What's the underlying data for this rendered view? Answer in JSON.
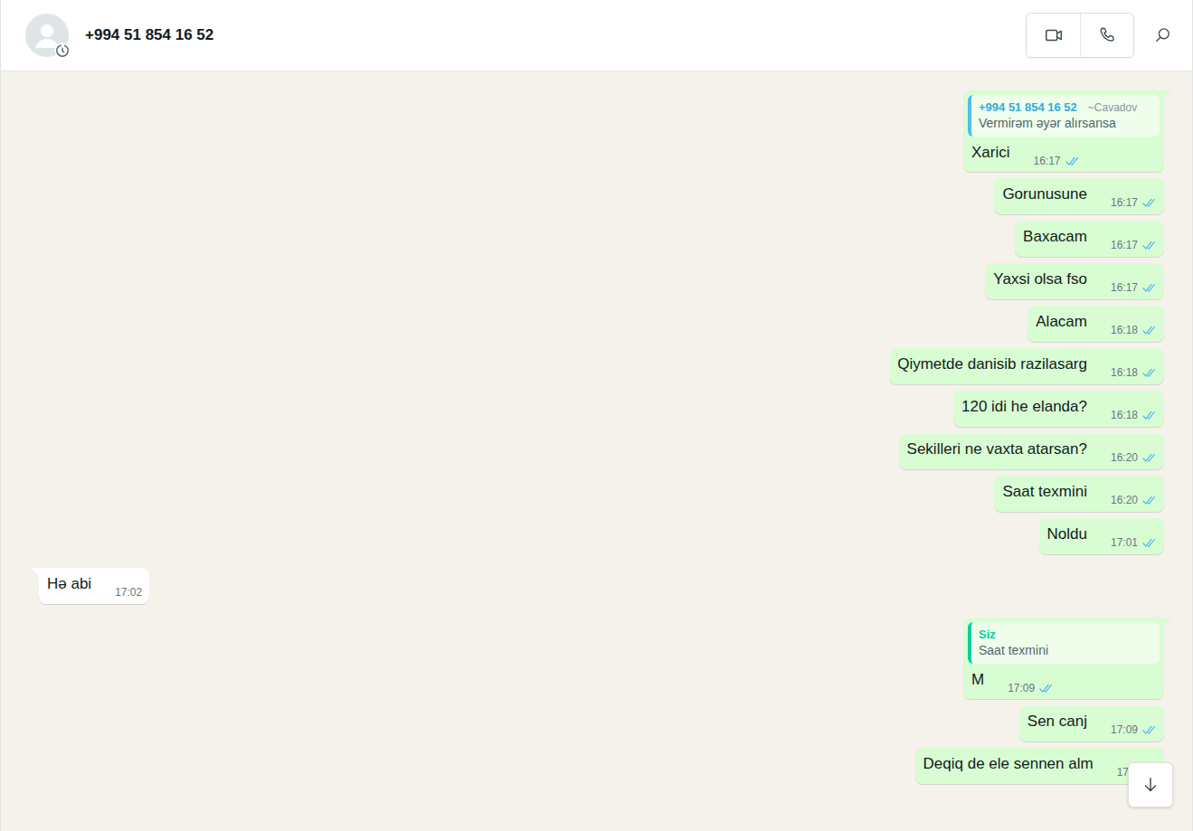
{
  "chat": {
    "title": "+994 51 854 16 52"
  },
  "messages": [
    {
      "out": true,
      "quote": {
        "author": "+994 51 854 16 52",
        "tag": "~Cavadov",
        "text": "Vermirəm əyər alırsansa",
        "mine": false
      },
      "text": "Xarici",
      "time": "16:17",
      "read": true
    },
    {
      "out": true,
      "quote": null,
      "text": "Gorunusune",
      "time": "16:17",
      "read": true
    },
    {
      "out": true,
      "quote": null,
      "text": "Baxacam",
      "time": "16:17",
      "read": true
    },
    {
      "out": true,
      "quote": null,
      "text": "Yaxsi olsa fso",
      "time": "16:17",
      "read": true
    },
    {
      "out": true,
      "quote": null,
      "text": "Alacam",
      "time": "16:18",
      "read": true
    },
    {
      "out": true,
      "quote": null,
      "text": "Qiymetde danisib razilasarg",
      "time": "16:18",
      "read": true
    },
    {
      "out": true,
      "quote": null,
      "text": "120 idi he elanda?",
      "time": "16:18",
      "read": true
    },
    {
      "out": true,
      "quote": null,
      "text": "Sekilleri ne vaxta atarsan?",
      "time": "16:20",
      "read": true
    },
    {
      "out": true,
      "quote": null,
      "text": "Saat texmini",
      "time": "16:20",
      "read": true
    },
    {
      "out": true,
      "quote": null,
      "text": "Noldu",
      "time": "17:01",
      "read": true
    },
    {
      "out": false,
      "quote": null,
      "text": "Hə abi",
      "time": "17:02",
      "read": false
    },
    {
      "out": true,
      "quote": {
        "author": "Siz",
        "tag": "",
        "text": "Saat texmini",
        "mine": true
      },
      "text": "M",
      "time": "17:09",
      "read": true
    },
    {
      "out": true,
      "quote": null,
      "text": "Sen canj",
      "time": "17:09",
      "read": true
    },
    {
      "out": true,
      "quote": null,
      "text": "Deqiq de ele sennen alm",
      "time": "17:0",
      "read": true
    }
  ]
}
